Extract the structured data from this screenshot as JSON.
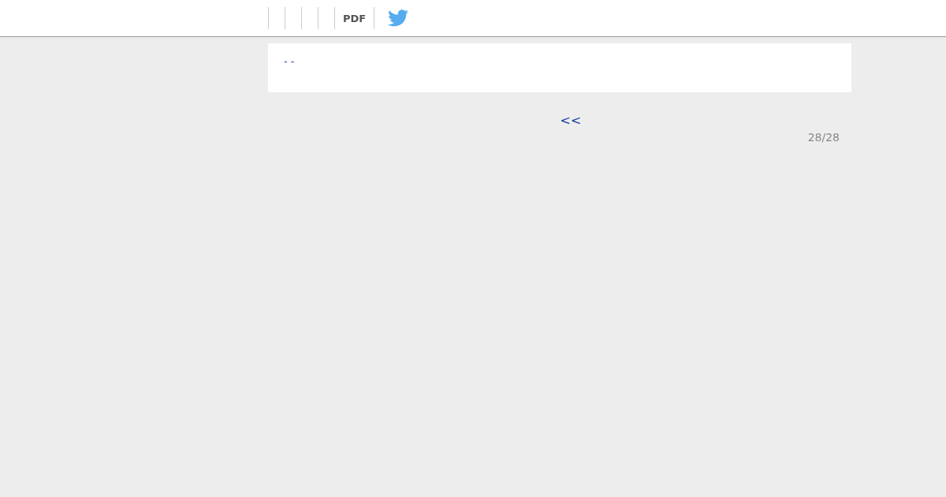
{
  "toolbar": {
    "pdf_button": "PDF"
  },
  "content": {
    "link": "- -"
  },
  "pagination": {
    "previous": "<<",
    "page_count": "28/28"
  }
}
